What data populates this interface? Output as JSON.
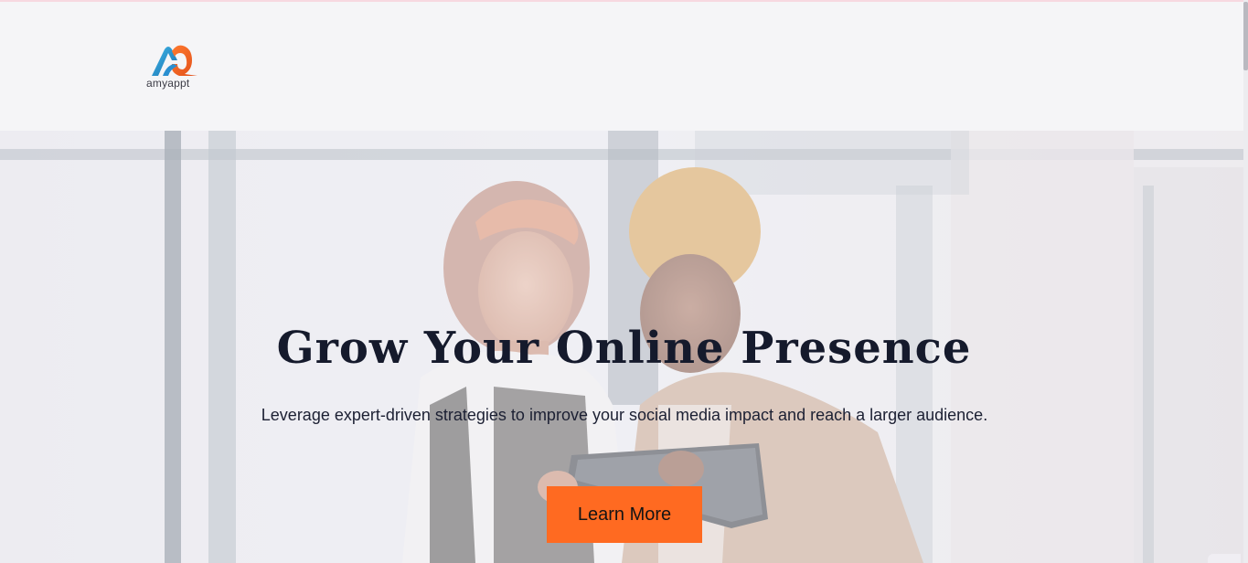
{
  "header": {
    "logo_text": "amyappt"
  },
  "hero": {
    "title": "Grow Your Online Presence",
    "subtitle": "Leverage expert-driven strategies to improve your social media impact and reach a larger audience.",
    "cta_label": "Learn More"
  },
  "colors": {
    "accent": "#ff6a21",
    "title": "#151a2c",
    "header_bg": "#f5f5f7"
  }
}
